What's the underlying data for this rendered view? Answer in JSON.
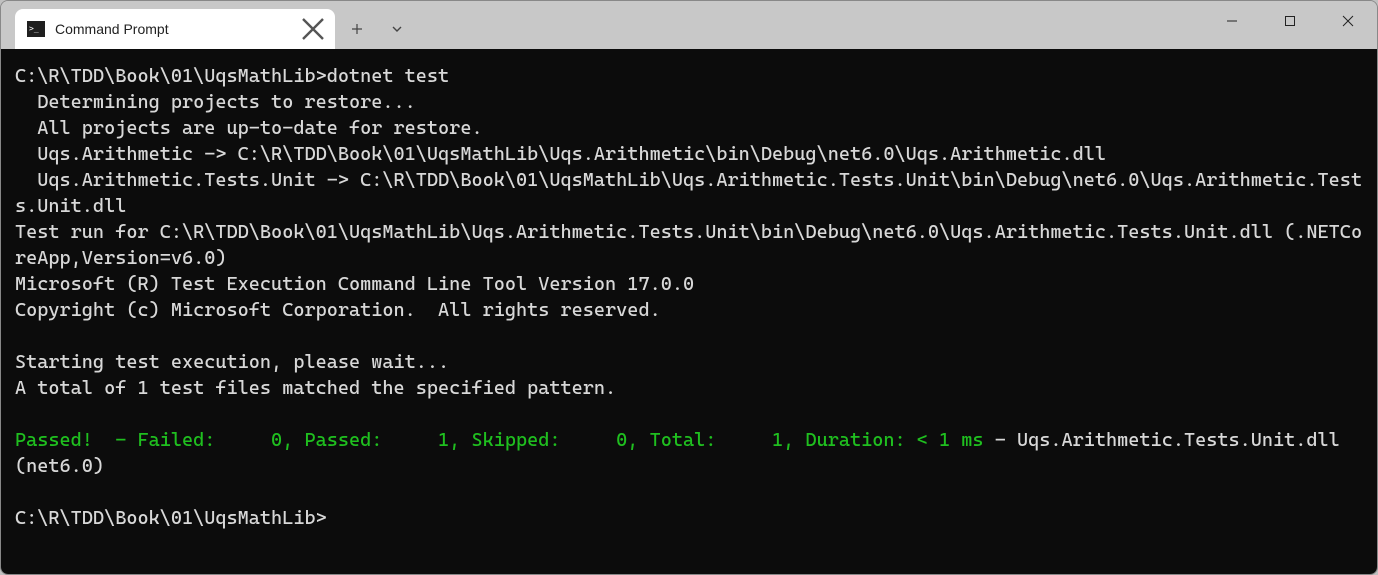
{
  "tab": {
    "title": "Command Prompt"
  },
  "terminal": {
    "prompt_path": "C:\\R\\TDD\\Book\\01\\UqsMathLib>",
    "command": "dotnet test",
    "line_determine": "  Determining projects to restore...",
    "line_uptodate": "  All projects are up-to-date for restore.",
    "line_build1": "  Uqs.Arithmetic -> C:\\R\\TDD\\Book\\01\\UqsMathLib\\Uqs.Arithmetic\\bin\\Debug\\net6.0\\Uqs.Arithmetic.dll",
    "line_build2": "  Uqs.Arithmetic.Tests.Unit -> C:\\R\\TDD\\Book\\01\\UqsMathLib\\Uqs.Arithmetic.Tests.Unit\\bin\\Debug\\net6.0\\Uqs.Arithmetic.Tests.Unit.dll",
    "line_testrun": "Test run for C:\\R\\TDD\\Book\\01\\UqsMathLib\\Uqs.Arithmetic.Tests.Unit\\bin\\Debug\\net6.0\\Uqs.Arithmetic.Tests.Unit.dll (.NETCoreApp,Version=v6.0)",
    "line_mstool": "Microsoft (R) Test Execution Command Line Tool Version 17.0.0",
    "line_copyright": "Copyright (c) Microsoft Corporation.  All rights reserved.",
    "line_starting": "Starting test execution, please wait...",
    "line_matched": "A total of 1 test files matched the specified pattern.",
    "result_green": "Passed!  - Failed:     0, Passed:     1, Skipped:     0, Total:     1, Duration: < 1 ms",
    "result_tail": " - Uqs.Arithmetic.Tests.Unit.dll (net6.0)",
    "final_prompt": "C:\\R\\TDD\\Book\\01\\UqsMathLib>"
  }
}
